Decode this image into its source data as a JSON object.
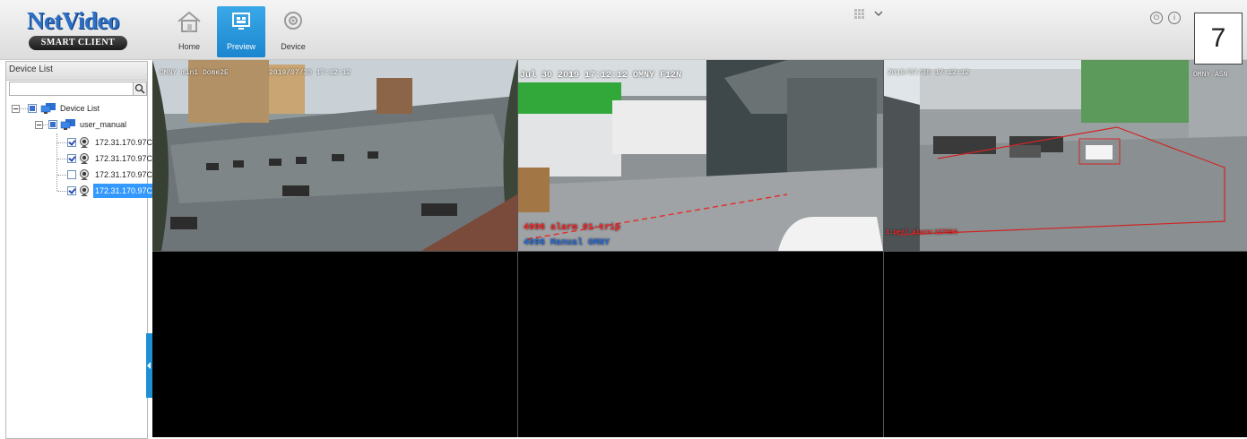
{
  "app": {
    "logo_brand": "NetVideo",
    "logo_sub": "SMART CLIENT"
  },
  "nav": {
    "home_label": "Home",
    "preview_label": "Preview",
    "device_label": "Device",
    "active": "Preview"
  },
  "toolbar": {
    "icons": [
      "layout-grid-icon",
      "chevron-down-icon",
      "power-icon",
      "info-icon"
    ],
    "info_glyph": "i",
    "power_glyph": "⏻"
  },
  "page_badge": "7",
  "sidebar": {
    "title": "Device List",
    "search_placeholder": "",
    "tree": {
      "root_label": "Device List",
      "group_label": "user_manual",
      "devices": [
        {
          "label": "172.31.170.97C",
          "checked": true,
          "selected": false
        },
        {
          "label": "172.31.170.97C",
          "checked": true,
          "selected": false
        },
        {
          "label": "172.31.170.97C",
          "checked": false,
          "selected": false
        },
        {
          "label": "172.31.170.97C",
          "checked": true,
          "selected": true
        }
      ]
    }
  },
  "grid": {
    "layout": "3x2",
    "cells": [
      {
        "id": 1,
        "osd_top_left": "OMNY mini Dome2E",
        "osd_top_right": "2019/07/30 17:12:12",
        "active": false
      },
      {
        "id": 2,
        "osd_top_left": "Jul 30 2019 17:12:12 OMNY F12N",
        "osd_alarm": "4096 alarm 01-trip",
        "osd_bottom": "4096 Manual OMNY",
        "active": false
      },
      {
        "id": 3,
        "osd_top_left": "2019/07/30 17:12:12",
        "osd_top_right": "OMNY A5N",
        "osd_alarm": "1:perl alarm:127694",
        "active": true
      },
      {
        "id": 4,
        "active": false
      },
      {
        "id": 5,
        "active": false
      },
      {
        "id": 6,
        "active": false
      }
    ]
  },
  "colors": {
    "accent": "#1e8fd4",
    "preview_tab": "#2a98dc",
    "active_cell_border": "#e02020",
    "selected_row": "#3399ff"
  }
}
